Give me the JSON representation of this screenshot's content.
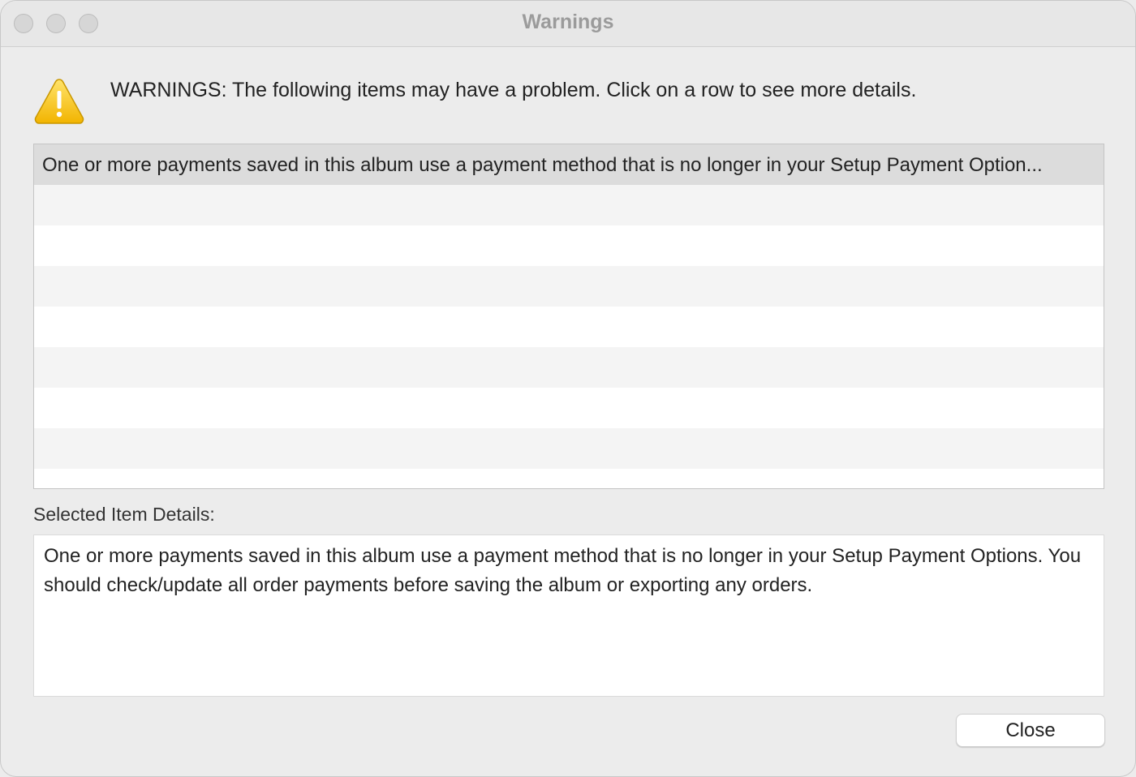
{
  "window": {
    "title": "Warnings"
  },
  "header": {
    "icon": "warning-triangle-icon",
    "message": "WARNINGS: The following items may have a problem. Click on a row to see more details."
  },
  "warnings_list": {
    "rows": [
      "One or more payments saved in this album use a payment method that is no longer in your Setup Payment Option..."
    ],
    "selected_index": 0
  },
  "details": {
    "label": "Selected Item Details:",
    "text": "One or more payments saved in this album use a payment method that is no longer in your Setup Payment Options. You should check/update all order payments before saving the album or exporting any orders."
  },
  "footer": {
    "close_label": "Close"
  },
  "colors": {
    "window_bg": "#ececec",
    "selected_row": "#dcdcdc",
    "alt_row": "#f4f4f4",
    "warning_yellow": "#f5c400"
  }
}
